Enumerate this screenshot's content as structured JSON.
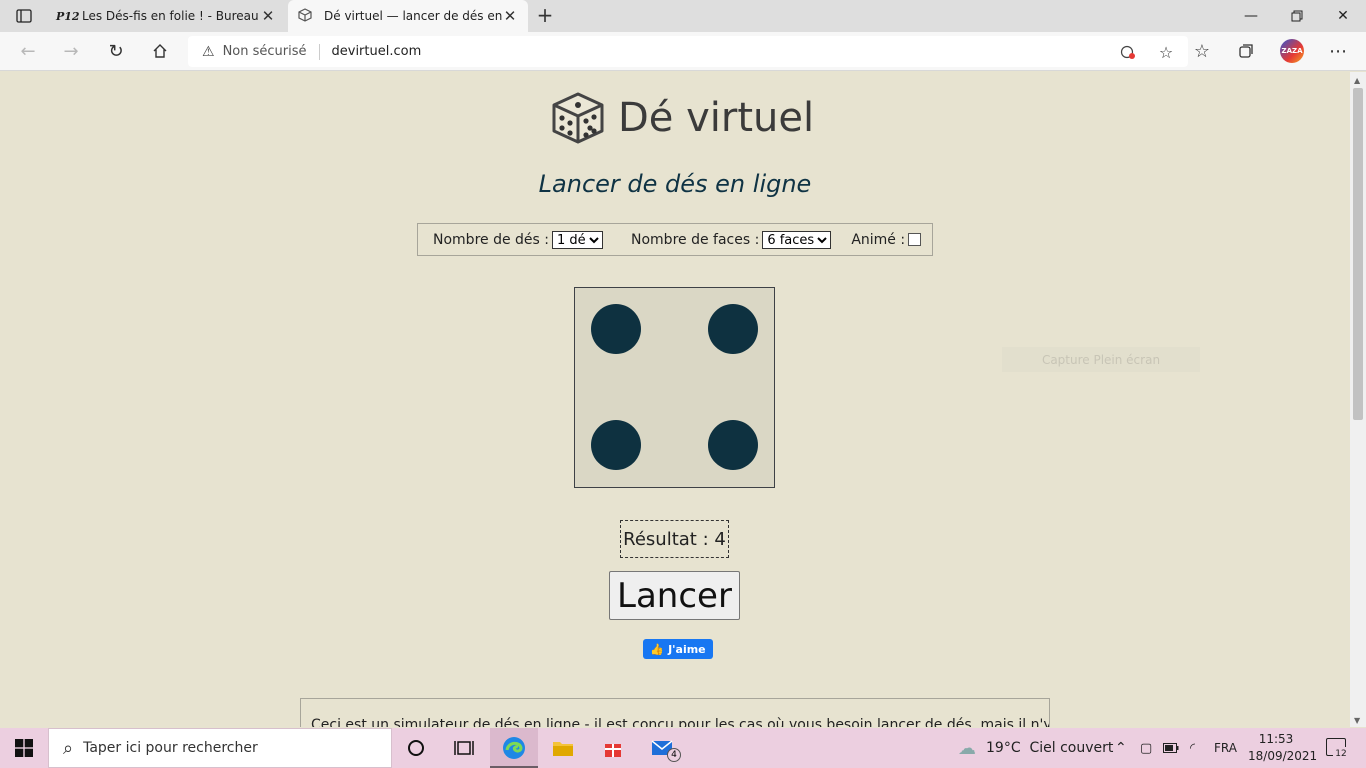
{
  "browser": {
    "tabs": [
      {
        "favicon": "P12",
        "title": "Les Dés-fis en folie ! - Bureau de"
      },
      {
        "favicon": "dice-favicon",
        "title": "Dé virtuel — lancer de dés en lig"
      }
    ],
    "security_label": "Non sécurisé",
    "url": "devirtuel.com",
    "profile_label": "ZAZA"
  },
  "page": {
    "site_title": "Dé virtuel",
    "subtitle": "Lancer de dés en ligne",
    "options": {
      "dice_count_label": "Nombre de dés :",
      "dice_count_value": "1 dé",
      "faces_label": "Nombre de faces :",
      "faces_value": "6 faces",
      "animated_label": "Animé :",
      "animated_checked": false
    },
    "die_value": 4,
    "result_text": "Résultat : 4",
    "roll_button": "Lancer",
    "fb_like": "J'aime",
    "ghost_overlay": "Capture Plein écran",
    "description": "Ceci est un simulateur de dés en ligne - il est conçu pour les cas où vous besoin lancer de dés, mais il n'y en a"
  },
  "taskbar": {
    "search_placeholder": "Taper ici pour rechercher",
    "weather": "19°C  Ciel couvert",
    "language": "FRA",
    "time": "11:53",
    "date": "18/09/2021",
    "mail_badge": "4",
    "notif_count": "12"
  }
}
